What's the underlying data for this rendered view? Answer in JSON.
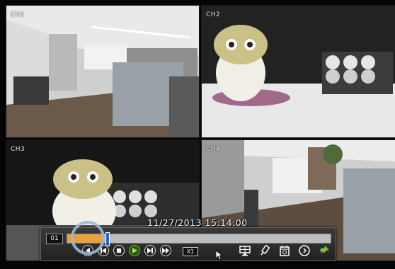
{
  "channels": [
    {
      "label": "CH1",
      "scene": "office-interior"
    },
    {
      "label": "CH2",
      "scene": "owl-figurine-closeup"
    },
    {
      "label": "CH3",
      "scene": "owl-figurine-cabinet"
    },
    {
      "label": "CH4",
      "scene": "office-corridor"
    }
  ],
  "timestamp": "11/27/2013 15:14:00",
  "playback": {
    "channel": "01",
    "speed": "X1",
    "timeline_progress_percent": 15,
    "cursor_position_percent": 15,
    "colors": {
      "timeline_bg": "#bdbdbd",
      "timeline_recorded": "#e9a23b",
      "cursor": "#2a66d9",
      "play_accent": "#7cc23a"
    },
    "controls": [
      {
        "name": "reverse-play-icon"
      },
      {
        "name": "step-back-icon"
      },
      {
        "name": "stop-icon"
      },
      {
        "name": "play-icon"
      },
      {
        "name": "step-forward-icon"
      },
      {
        "name": "fast-forward-icon"
      }
    ],
    "tools": [
      {
        "name": "monitor-layout-icon"
      },
      {
        "name": "usb-backup-icon"
      },
      {
        "name": "search-calendar-icon"
      },
      {
        "name": "exit-icon"
      },
      {
        "name": "pin-toggle-icon"
      }
    ]
  }
}
